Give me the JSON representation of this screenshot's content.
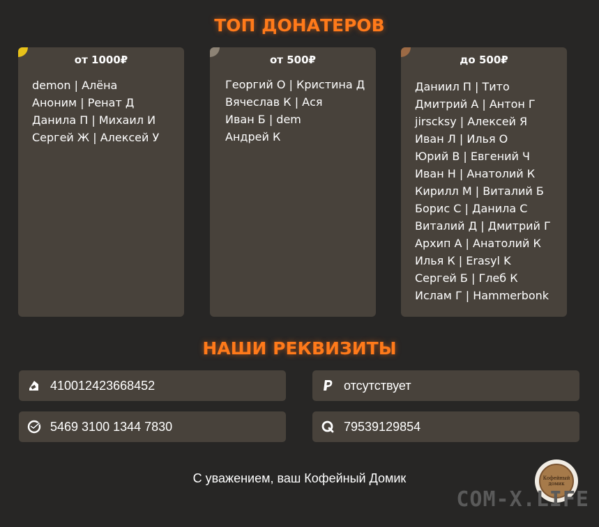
{
  "top_title": "ТОП ДОНАТЕРОВ",
  "tiers": [
    {
      "title": "от 1000₽",
      "corner_color": "#e8c21a",
      "donors": [
        "demon | Алёна",
        "Аноним | Ренат Д",
        "Данила П | Михаил И",
        "Сергей Ж | Алексей У"
      ]
    },
    {
      "title": "от 500₽",
      "corner_color": "#8d8375",
      "donors": [
        "Георгий О | Кристина Д",
        "Вячеслав К | Ася",
        "Иван Б | dem",
        "Андрей К"
      ]
    },
    {
      "title": "до 500₽",
      "corner_color": "#9c6a45",
      "donors": [
        "Даниил П | Тито",
        "Дмитрий А | Антон Г",
        "jirscksy | Алексей Я",
        "Иван Л | Илья О",
        "Юрий В | Евгений Ч",
        "Иван Н | Анатолий К",
        "Кирилл М | Виталий Б",
        "Борис С | Данила С",
        "Виталий Д | Дмитрий Г",
        "Архип А | Анатолий К",
        "Илья К | Erasyl K",
        "Сергей Б | Глеб К",
        "Ислам Г | Hammerbonk"
      ]
    }
  ],
  "requisites_title": "НАШИ РЕКВИЗИТЫ",
  "requisites": {
    "yoomoney": {
      "icon": "yoomoney-icon",
      "value": "410012423668452"
    },
    "paypal": {
      "icon": "paypal-icon",
      "value": "отсутствует"
    },
    "sberbank": {
      "icon": "sberbank-icon",
      "value": "5469 3100 1344 7830"
    },
    "qiwi": {
      "icon": "qiwi-icon",
      "value": "79539129854"
    }
  },
  "footer_text": "С уважением, ваш Кофейный Домик",
  "logo_text": "Кофейный домик",
  "watermark": "COM-X.LIFE",
  "colors": {
    "accent": "#ff7a1a",
    "panel": "#48423b",
    "background": "#272625"
  }
}
